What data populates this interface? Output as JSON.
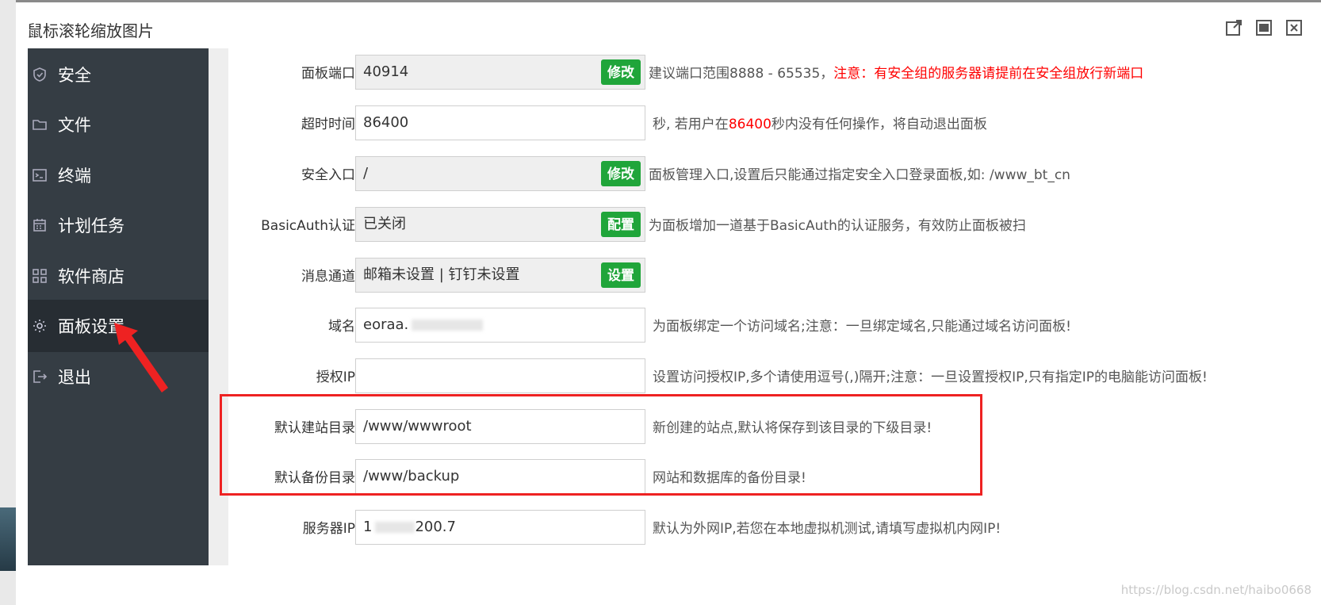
{
  "window": {
    "title": "鼠标滚轮缩放图片",
    "controls": [
      "external-link-icon",
      "maximize-icon",
      "close-icon"
    ]
  },
  "sidebar": {
    "items": [
      {
        "label": "安全",
        "icon": "shield-icon"
      },
      {
        "label": "文件",
        "icon": "folder-icon"
      },
      {
        "label": "终端",
        "icon": "terminal-icon"
      },
      {
        "label": "计划任务",
        "icon": "calendar-icon"
      },
      {
        "label": "软件商店",
        "icon": "grid-icon"
      },
      {
        "label": "面板设置",
        "icon": "gear-icon",
        "active": true
      },
      {
        "label": "退出",
        "icon": "logout-icon"
      }
    ]
  },
  "settings": {
    "panel_port": {
      "label": "面板端口",
      "value": "40914",
      "button": "修改",
      "desc": "建议端口范围8888 - 65535，",
      "desc_warn": "注意：有安全组的服务器请提前在安全组放行新端口"
    },
    "timeout": {
      "label": "超时时间",
      "value": "86400",
      "desc_pre": "秒, 若用户在",
      "desc_num": "86400",
      "desc_post": "秒内没有任何操作，将自动退出面板"
    },
    "security_entry": {
      "label": "安全入口",
      "value": "/",
      "button": "修改",
      "desc": "面板管理入口,设置后只能通过指定安全入口登录面板,如: /www_bt_cn"
    },
    "basic_auth": {
      "label": "BasicAuth认证",
      "value": "已关闭",
      "button": "配置",
      "desc": "为面板增加一道基于BasicAuth的认证服务，有效防止面板被扫"
    },
    "message_channel": {
      "label": "消息通道",
      "value": "邮箱未设置 | 钉钉未设置",
      "button": "设置",
      "desc": ""
    },
    "domain": {
      "label": "域名",
      "value": "eoraa.",
      "desc": "为面板绑定一个访问域名;注意：一旦绑定域名,只能通过域名访问面板!"
    },
    "auth_ip": {
      "label": "授权IP",
      "value": "",
      "desc": "设置访问授权IP,多个请使用逗号(,)隔开;注意：一旦设置授权IP,只有指定IP的电脑能访问面板!"
    },
    "default_site_dir": {
      "label": "默认建站目录",
      "value": "/www/wwwroot",
      "desc": "新创建的站点,默认将保存到该目录的下级目录!"
    },
    "default_backup_dir": {
      "label": "默认备份目录",
      "value": "/www/backup",
      "desc": "网站和数据库的备份目录!"
    },
    "server_ip": {
      "label": "服务器IP",
      "value": "1",
      "value_tail": "200.7",
      "desc": "默认为外网IP,若您在本地虚拟机测试,请填写虚拟机内网IP!"
    }
  },
  "watermark": "https://blog.csdn.net/haibo0668",
  "colors": {
    "sidebar": "#353d44",
    "sidebar_active": "#272d33",
    "button": "#20a53a",
    "warning": "#ff0000",
    "highlight": "#ee2222"
  }
}
